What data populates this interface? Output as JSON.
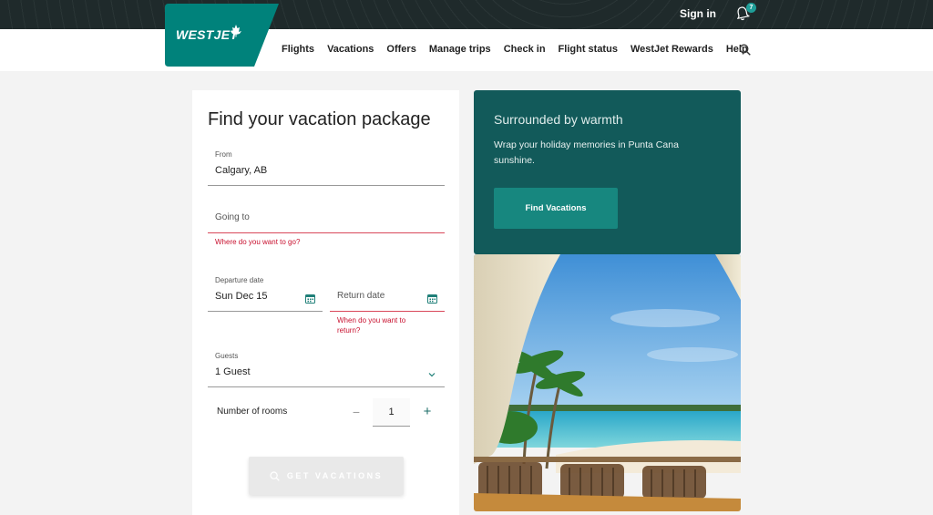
{
  "header": {
    "brand": "WESTJET",
    "sign_in": "Sign in",
    "notification_count": "7",
    "nav": [
      "Flights",
      "Vacations",
      "Offers",
      "Manage trips",
      "Check in",
      "Flight status",
      "WestJet Rewards",
      "Help"
    ]
  },
  "form": {
    "title": "Find your vacation package",
    "from": {
      "label": "From",
      "value": "Calgary, AB"
    },
    "going_to": {
      "placeholder": "Going to",
      "error": "Where do you want to go?"
    },
    "departure": {
      "label": "Departure date",
      "value": "Sun Dec 15"
    },
    "return_date": {
      "placeholder": "Return date",
      "error_line1": "When do you want to",
      "error_line2": "return?"
    },
    "guests": {
      "label": "Guests",
      "value": "1 Guest"
    },
    "rooms": {
      "label": "Number of rooms",
      "value": "1",
      "minus": "−",
      "plus": "+"
    },
    "submit": "GET VACATIONS"
  },
  "promo": {
    "title": "Surrounded by warmth",
    "text": "Wrap your holiday memories in Punta Cana sunshine.",
    "button": "Find Vacations"
  },
  "colors": {
    "brand_teal": "#00827b",
    "promo_bg": "#125a5a",
    "error": "#c8102e",
    "topbar": "#1f2a2b"
  }
}
